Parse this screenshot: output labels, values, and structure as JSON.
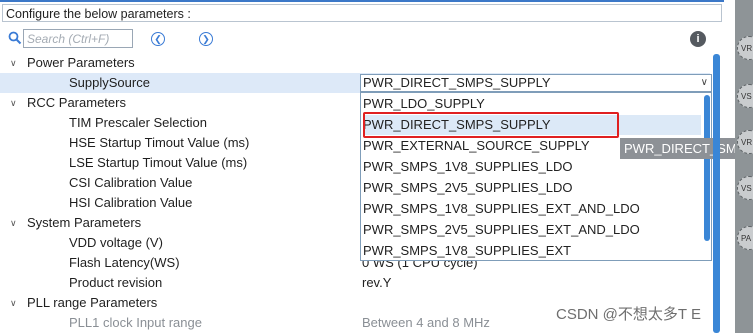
{
  "header": {
    "title": "Configure the below parameters :"
  },
  "toolbar": {
    "search_placeholder": "Search (Ctrl+F)",
    "prev_icon": "left-arrow-circle-icon",
    "next_icon": "right-arrow-circle-icon",
    "info_icon": "info-icon"
  },
  "tree": {
    "power": {
      "label": "Power Parameters",
      "supply_source": {
        "label": "SupplySource",
        "value": "PWR_DIRECT_SMPS_SUPPLY"
      }
    },
    "rcc": {
      "label": "RCC Parameters",
      "items": [
        {
          "label": "TIM Prescaler Selection"
        },
        {
          "label": "HSE Startup Timout Value (ms)"
        },
        {
          "label": "LSE Startup Timout Value (ms)"
        },
        {
          "label": "CSI Calibration Value"
        },
        {
          "label": "HSI Calibration Value"
        }
      ]
    },
    "system": {
      "label": "System Parameters",
      "items": [
        {
          "label": "VDD voltage (V)"
        },
        {
          "label": "Flash Latency(WS)",
          "value": "0 WS (1 CPU cycle)"
        },
        {
          "label": "Product revision",
          "value": "rev.Y"
        }
      ]
    },
    "pll": {
      "label": "PLL range Parameters",
      "items": [
        {
          "label": "PLL1 clock Input range",
          "value": "Between 4 and 8 MHz"
        }
      ]
    }
  },
  "dropdown": {
    "selected": "PWR_DIRECT_SMPS_SUPPLY",
    "options": [
      "PWR_LDO_SUPPLY",
      "PWR_DIRECT_SMPS_SUPPLY",
      "PWR_EXTERNAL_SOURCE_SUPPLY",
      "PWR_SMPS_1V8_SUPPLIES_LDO",
      "PWR_SMPS_2V5_SUPPLIES_LDO",
      "PWR_SMPS_1V8_SUPPLIES_EXT_AND_LDO",
      "PWR_SMPS_2V5_SUPPLIES_EXT_AND_LDO",
      "PWR_SMPS_1V8_SUPPLIES_EXT"
    ],
    "tooltip": "PWR_DIRECT_SMPS_SUPPLY"
  },
  "side_panel": {
    "pins": [
      "VR",
      "VS",
      "VR",
      "VS",
      "PA"
    ]
  },
  "watermark": "CSDN @不想太多T E",
  "colors": {
    "accent": "#3a86d6",
    "selection": "#dde9f8",
    "highlight_border": "#e02020"
  }
}
